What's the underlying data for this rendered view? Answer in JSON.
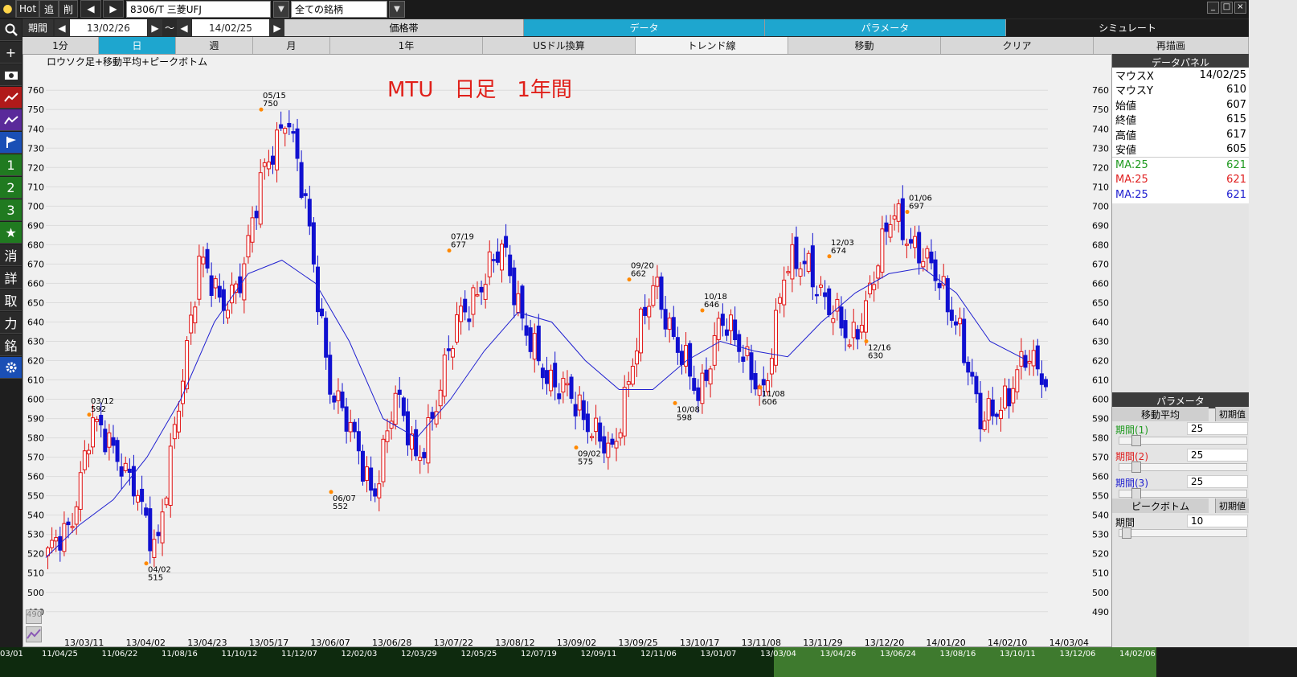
{
  "toolbar": {
    "hot": "Hot",
    "tsui": "追",
    "saku": "削",
    "symbol": "8306/T 三菱UFJ",
    "scope": "全ての銘柄",
    "period_label": "期間",
    "date_from": "13/02/26",
    "tilde": "～",
    "date_to": "14/02/25",
    "tabs": [
      "価格帯",
      "データ",
      "パラメータ",
      "シミュレート"
    ]
  },
  "timeframes": [
    "1分",
    "日",
    "週",
    "月",
    "1年"
  ],
  "actions": [
    "USドル換算",
    "トレンド線",
    "移動",
    "クリア",
    "再描画"
  ],
  "left_tools": [
    "search-icon",
    "crosshair-icon",
    "camera-icon",
    "line-chart-icon",
    "line-chart-icon",
    "flag-icon",
    "1",
    "2",
    "3",
    "★",
    "消",
    "詳",
    "取",
    "力",
    "銘",
    "gear-icon"
  ],
  "chart_caption": "ロウソク足+移動平均+ピークボトム",
  "chart_title": "MTU　日足　1年間",
  "data_panel": {
    "title": "データパネル",
    "rows": [
      {
        "label": "マウスX",
        "value": "14/02/25"
      },
      {
        "label": "マウスY",
        "value": "610"
      },
      {
        "label": "始値",
        "value": "607"
      },
      {
        "label": "終値",
        "value": "615"
      },
      {
        "label": "高値",
        "value": "617"
      },
      {
        "label": "安値",
        "value": "605"
      }
    ],
    "ma": [
      {
        "label": "MA:25",
        "value": "621",
        "color": "#1f9a1f"
      },
      {
        "label": "MA:25",
        "value": "621",
        "color": "#e02020"
      },
      {
        "label": "MA:25",
        "value": "621",
        "color": "#2020d0"
      }
    ]
  },
  "params_panel": {
    "title": "パラメータ",
    "ma_title": "移動平均",
    "reset": "初期值",
    "periods": [
      {
        "label": "期間(1)",
        "value": "25",
        "color": "#1f9a1f",
        "level": 0.1
      },
      {
        "label": "期間(2)",
        "value": "25",
        "color": "#e02020",
        "level": 0.1
      },
      {
        "label": "期間(3)",
        "value": "25",
        "color": "#2020d0",
        "level": 0.1
      }
    ],
    "pb_title": "ピークボトム",
    "pb_reset": "初期値",
    "pb_period": {
      "label": "期間",
      "value": "10",
      "level": 0.02
    }
  },
  "x_dates": [
    "13/03/11",
    "13/04/02",
    "13/04/23",
    "13/05/17",
    "13/06/07",
    "13/06/28",
    "13/07/22",
    "13/08/12",
    "13/09/02",
    "13/09/25",
    "13/10/17",
    "13/11/08",
    "13/11/29",
    "13/12/20",
    "14/01/20",
    "14/02/10",
    "14/03/04"
  ],
  "overview_dates": [
    "03/01",
    "11/04/25",
    "11/06/22",
    "11/08/16",
    "11/10/12",
    "11/12/07",
    "12/02/03",
    "12/03/29",
    "12/05/25",
    "12/07/19",
    "12/09/11",
    "12/11/06",
    "13/01/07",
    "13/03/04",
    "13/04/26",
    "13/06/24",
    "13/08/16",
    "13/10/11",
    "13/12/06",
    "14/02/06"
  ],
  "colors": {
    "up": "#e01010",
    "down": "#1010d0",
    "ma": "#2020d0",
    "accent": "#1ea6cf"
  },
  "chart_data": {
    "type": "candlestick",
    "ylim": [
      482,
      768
    ],
    "y_ticks": [
      490,
      500,
      510,
      520,
      530,
      540,
      550,
      560,
      570,
      580,
      590,
      600,
      610,
      620,
      630,
      640,
      650,
      660,
      670,
      680,
      690,
      700,
      710,
      720,
      730,
      740,
      750,
      760
    ],
    "anchors": [
      {
        "d": "13/02/26",
        "v": 520
      },
      {
        "d": "03/05",
        "v": 530
      },
      {
        "d": "03/12",
        "v": 592
      },
      {
        "d": "03/20",
        "v": 570
      },
      {
        "d": "03/28",
        "v": 560
      },
      {
        "d": "04/02",
        "v": 515
      },
      {
        "d": "04/08",
        "v": 600
      },
      {
        "d": "04/16",
        "v": 670
      },
      {
        "d": "04/25",
        "v": 650
      },
      {
        "d": "05/07",
        "v": 665
      },
      {
        "d": "05/13",
        "v": 720
      },
      {
        "d": "05/15",
        "v": 750
      },
      {
        "d": "05/21",
        "v": 690
      },
      {
        "d": "05/28",
        "v": 610
      },
      {
        "d": "06/03",
        "v": 580
      },
      {
        "d": "06/07",
        "v": 552
      },
      {
        "d": "06/13",
        "v": 600
      },
      {
        "d": "06/20",
        "v": 570
      },
      {
        "d": "06/27",
        "v": 600
      },
      {
        "d": "07/05",
        "v": 645
      },
      {
        "d": "07/12",
        "v": 660
      },
      {
        "d": "07/19",
        "v": 677
      },
      {
        "d": "07/26",
        "v": 640
      },
      {
        "d": "08/02",
        "v": 605
      },
      {
        "d": "08/12",
        "v": 610
      },
      {
        "d": "08/22",
        "v": 580
      },
      {
        "d": "09/02",
        "v": 575
      },
      {
        "d": "09/10",
        "v": 620
      },
      {
        "d": "09/20",
        "v": 662
      },
      {
        "d": "09/30",
        "v": 628
      },
      {
        "d": "10/08",
        "v": 598
      },
      {
        "d": "10/18",
        "v": 646
      },
      {
        "d": "10/28",
        "v": 620
      },
      {
        "d": "11/08",
        "v": 606
      },
      {
        "d": "11/19",
        "v": 665
      },
      {
        "d": "12/03",
        "v": 674
      },
      {
        "d": "12/10",
        "v": 645
      },
      {
        "d": "12/16",
        "v": 630
      },
      {
        "d": "12/24",
        "v": 660
      },
      {
        "d": "14/01/06",
        "v": 697
      },
      {
        "d": "01/15",
        "v": 680
      },
      {
        "d": "01/23",
        "v": 660
      },
      {
        "d": "01/30",
        "v": 640
      },
      {
        "d": "02/05",
        "v": 585
      },
      {
        "d": "02/12",
        "v": 600
      },
      {
        "d": "02/18",
        "v": 620
      },
      {
        "d": "02/25",
        "v": 610
      }
    ],
    "ma25": [
      518,
      535,
      548,
      570,
      600,
      640,
      665,
      672,
      660,
      630,
      590,
      580,
      600,
      625,
      645,
      640,
      620,
      605,
      605,
      620,
      630,
      625,
      622,
      640,
      655,
      665,
      668,
      655,
      630,
      621
    ],
    "peaks": [
      {
        "date": "05/15",
        "value": "750",
        "kind": "peak"
      },
      {
        "date": "03/12",
        "value": "592",
        "kind": "peak"
      },
      {
        "date": "07/19",
        "value": "677",
        "kind": "peak"
      },
      {
        "date": "09/20",
        "value": "662",
        "kind": "peak"
      },
      {
        "date": "10/18",
        "value": "646",
        "kind": "peak"
      },
      {
        "date": "12/03",
        "value": "674",
        "kind": "peak"
      },
      {
        "date": "01/06",
        "value": "697",
        "kind": "peak"
      },
      {
        "date": "04/02",
        "value": "515",
        "kind": "bottom"
      },
      {
        "date": "06/07",
        "value": "552",
        "kind": "bottom"
      },
      {
        "date": "09/02",
        "value": "575",
        "kind": "bottom"
      },
      {
        "date": "10/08",
        "value": "598",
        "kind": "bottom"
      },
      {
        "date": "11/08",
        "value": "606",
        "kind": "bottom"
      },
      {
        "date": "12/16",
        "value": "630",
        "kind": "bottom"
      }
    ]
  }
}
